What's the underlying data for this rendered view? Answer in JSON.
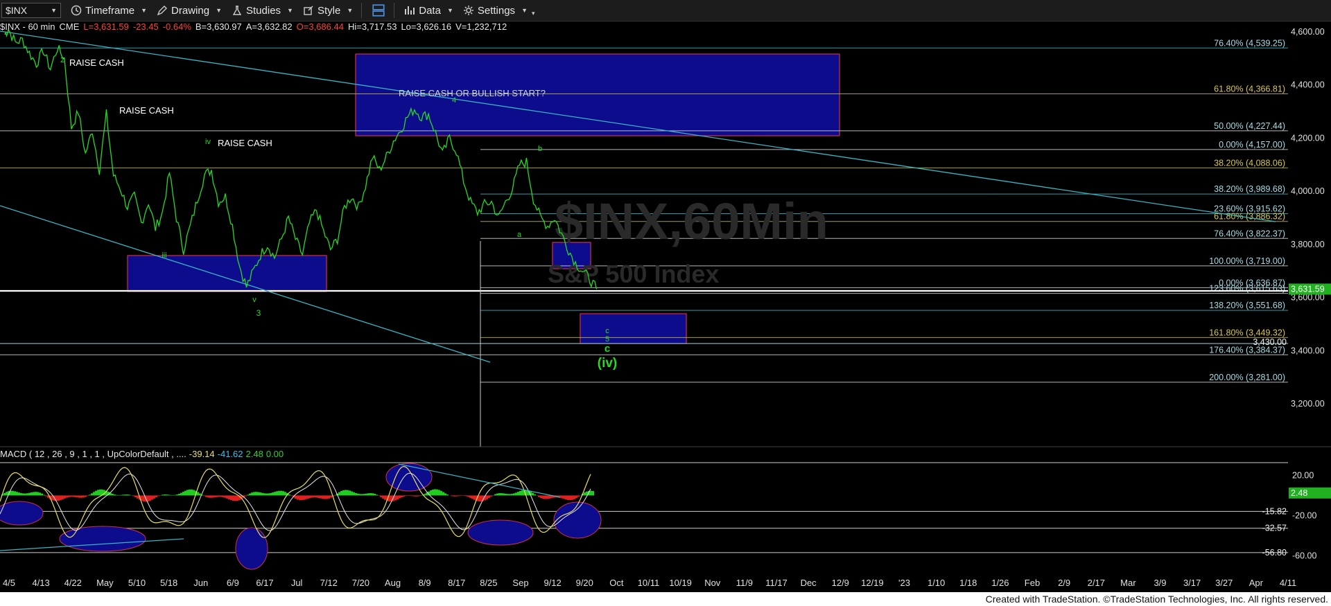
{
  "toolbar": {
    "symbol": "$INX",
    "timeframe": "Timeframe",
    "drawing": "Drawing",
    "studies": "Studies",
    "style": "Style",
    "data": "Data",
    "settings": "Settings"
  },
  "info": {
    "title": "$INX - 60 min",
    "exchange": "CME",
    "last": "L=3,631.59",
    "change": "-23.45",
    "pct": "-0.64%",
    "bid": "B=3,630.97",
    "ask": "A=3,632.82",
    "open": "O=3,686.44",
    "high": "Hi=3,717.53",
    "low": "Lo=3,626.16",
    "volume": "V=1,232,712"
  },
  "macd_info": {
    "label": "MACD ( 12 , 26 , 9 , 1 , 1 , UpColorDefault , ....",
    "v1": "-39.14",
    "v2": "-41.62",
    "v3": "2.48",
    "v4": "0.00"
  },
  "footer": "Created with TradeStation. ©TradeStation Technologies, Inc. All rights reserved.",
  "watermark": {
    "line1": "$INX,60Min",
    "line2": "S&P 500 Index"
  },
  "colors": {
    "price": "#22dd22",
    "box": "#0c0c8c",
    "box_border": "#d0304a",
    "trend": "#38b6c4",
    "macd_line": "#e8e060",
    "signal_line": "#e8e8e8",
    "hist_up": "#20cc20",
    "hist_down": "#e02020",
    "last_price_tag": "#20b020"
  },
  "chart_data": {
    "type": "line",
    "title": "$INX - 60 min",
    "price_axis": {
      "ylim": [
        3130,
        4620
      ],
      "ticks": [
        "4,600.00",
        "4,400.00",
        "4,200.00",
        "4,000.00",
        "3,800.00",
        "3,600.00",
        "3,400.00",
        "3,200.00"
      ]
    },
    "x_ticks": [
      "4/5",
      "4/13",
      "4/22",
      "May",
      "5/10",
      "5/18",
      "Jun",
      "6/9",
      "6/17",
      "Jul",
      "7/12",
      "7/20",
      "Aug",
      "8/9",
      "8/17",
      "8/25",
      "Sep",
      "9/12",
      "9/20",
      "Oct",
      "10/11",
      "10/19",
      "Nov",
      "11/9",
      "11/17",
      "Dec",
      "12/9",
      "12/19",
      "'23",
      "1/10",
      "1/18",
      "1/26",
      "Feb",
      "2/9",
      "2/17",
      "Mar",
      "3/9",
      "3/17",
      "3/27",
      "Apr",
      "4/11"
    ],
    "series": [
      {
        "name": "$INX",
        "values": [
          [
            0.5,
            4590
          ],
          [
            1,
            4610
          ],
          [
            2,
            4560
          ],
          [
            3,
            4570
          ],
          [
            4,
            4520
          ],
          [
            5,
            4480
          ],
          [
            6,
            4530
          ],
          [
            7,
            4460
          ],
          [
            8,
            4540
          ],
          [
            9,
            4500
          ],
          [
            10,
            4240
          ],
          [
            11,
            4300
          ],
          [
            12,
            4140
          ],
          [
            13,
            4230
          ],
          [
            14,
            4080
          ],
          [
            15,
            4290
          ],
          [
            16,
            4060
          ],
          [
            17,
            4010
          ],
          [
            18,
            3940
          ],
          [
            19,
            3980
          ],
          [
            20,
            3880
          ],
          [
            21,
            3960
          ],
          [
            22,
            3860
          ],
          [
            23,
            3920
          ],
          [
            24,
            4070
          ],
          [
            25,
            3900
          ],
          [
            26,
            3780
          ],
          [
            27,
            3870
          ],
          [
            28,
            3970
          ],
          [
            29,
            4060
          ],
          [
            30,
            4080
          ],
          [
            31,
            3960
          ],
          [
            32,
            3980
          ],
          [
            33,
            3870
          ],
          [
            34,
            3720
          ],
          [
            35,
            3640
          ],
          [
            36,
            3700
          ],
          [
            37,
            3760
          ],
          [
            38,
            3800
          ],
          [
            39,
            3750
          ],
          [
            40,
            3820
          ],
          [
            41,
            3900
          ],
          [
            42,
            3820
          ],
          [
            43,
            3760
          ],
          [
            44,
            3880
          ],
          [
            45,
            3930
          ],
          [
            46,
            3850
          ],
          [
            47,
            3780
          ],
          [
            48,
            3820
          ],
          [
            49,
            3940
          ],
          [
            50,
            3980
          ],
          [
            51,
            3940
          ],
          [
            52,
            4020
          ],
          [
            53,
            4130
          ],
          [
            54,
            4080
          ],
          [
            55,
            4130
          ],
          [
            56,
            4190
          ],
          [
            57,
            4230
          ],
          [
            58,
            4280
          ],
          [
            59,
            4310
          ],
          [
            60,
            4280
          ],
          [
            61,
            4290
          ],
          [
            62,
            4220
          ],
          [
            63,
            4140
          ],
          [
            64,
            4200
          ],
          [
            65,
            4150
          ],
          [
            66,
            4040
          ],
          [
            67,
            3960
          ],
          [
            68,
            3920
          ],
          [
            69,
            3950
          ],
          [
            70,
            3960
          ],
          [
            71,
            3900
          ],
          [
            72,
            3960
          ],
          [
            73,
            4010
          ],
          [
            74,
            4100
          ],
          [
            75,
            4110
          ],
          [
            76,
            3970
          ],
          [
            77,
            3900
          ],
          [
            78,
            3870
          ],
          [
            79,
            3900
          ],
          [
            80,
            3840
          ],
          [
            81,
            3780
          ],
          [
            82,
            3730
          ],
          [
            83,
            3700
          ],
          [
            84,
            3670
          ],
          [
            85,
            3631.59
          ]
        ]
      }
    ],
    "fib_levels": [
      {
        "label": "76.40% (4,539.25)",
        "value": 4539.25
      },
      {
        "label": "61.80% (4,366.81)",
        "value": 4366.81
      },
      {
        "label": "50.00% (4,227.44)",
        "value": 4227.44
      },
      {
        "label": "0.00% (4,157.00)",
        "value": 4157.0
      },
      {
        "label": "38.20% (4,088.06)",
        "value": 4088.06
      },
      {
        "label": "38.20% (3,989.68)",
        "value": 3989.68
      },
      {
        "label": "23.60% (3,915.62)",
        "value": 3915.62
      },
      {
        "label": "61.80% (3,886.32)",
        "value": 3886.32
      },
      {
        "label": "76.40% (3,822.37)",
        "value": 3822.37
      },
      {
        "label": "100.00% (3,719.00)",
        "value": 3719.0
      },
      {
        "label": "0.00% (3,636.87)",
        "value": 3636.87
      },
      {
        "label": "123.60% (3,615.63)",
        "value": 3615.63
      },
      {
        "label": "138.20% (3,551.68)",
        "value": 3551.68
      },
      {
        "label": "161.80% (3,449.32)",
        "value": 3449.32
      },
      {
        "label": "176.40% (3,384.37)",
        "value": 3384.37
      },
      {
        "label": "200.00% (3,281.00)",
        "value": 3281.0
      }
    ],
    "price_tags": [
      {
        "label": "3,430.00",
        "value": 3430.0
      }
    ],
    "last_price": {
      "label": "3,631.59",
      "value": 3631.59
    },
    "annotations": [
      "RAISE CASH",
      "RAISE CASH",
      "RAISE CASH",
      "RAISE CASH OR BULLISH START?",
      "2",
      "iii",
      "iv",
      "v",
      "3",
      "4",
      "a",
      "b",
      "c",
      "5",
      "c",
      "(iv)"
    ],
    "macd": {
      "ylim": [
        -72,
        34
      ],
      "ticks": [
        "20.00",
        "-20.00",
        "-60.00"
      ],
      "levels": [
        {
          "label": "-15.82",
          "value": -15.82
        },
        {
          "label": "-32.57",
          "value": -32.57
        },
        {
          "label": "-56.80",
          "value": -56.8
        }
      ],
      "last": {
        "label": "2.48",
        "value": 2.48
      }
    }
  }
}
